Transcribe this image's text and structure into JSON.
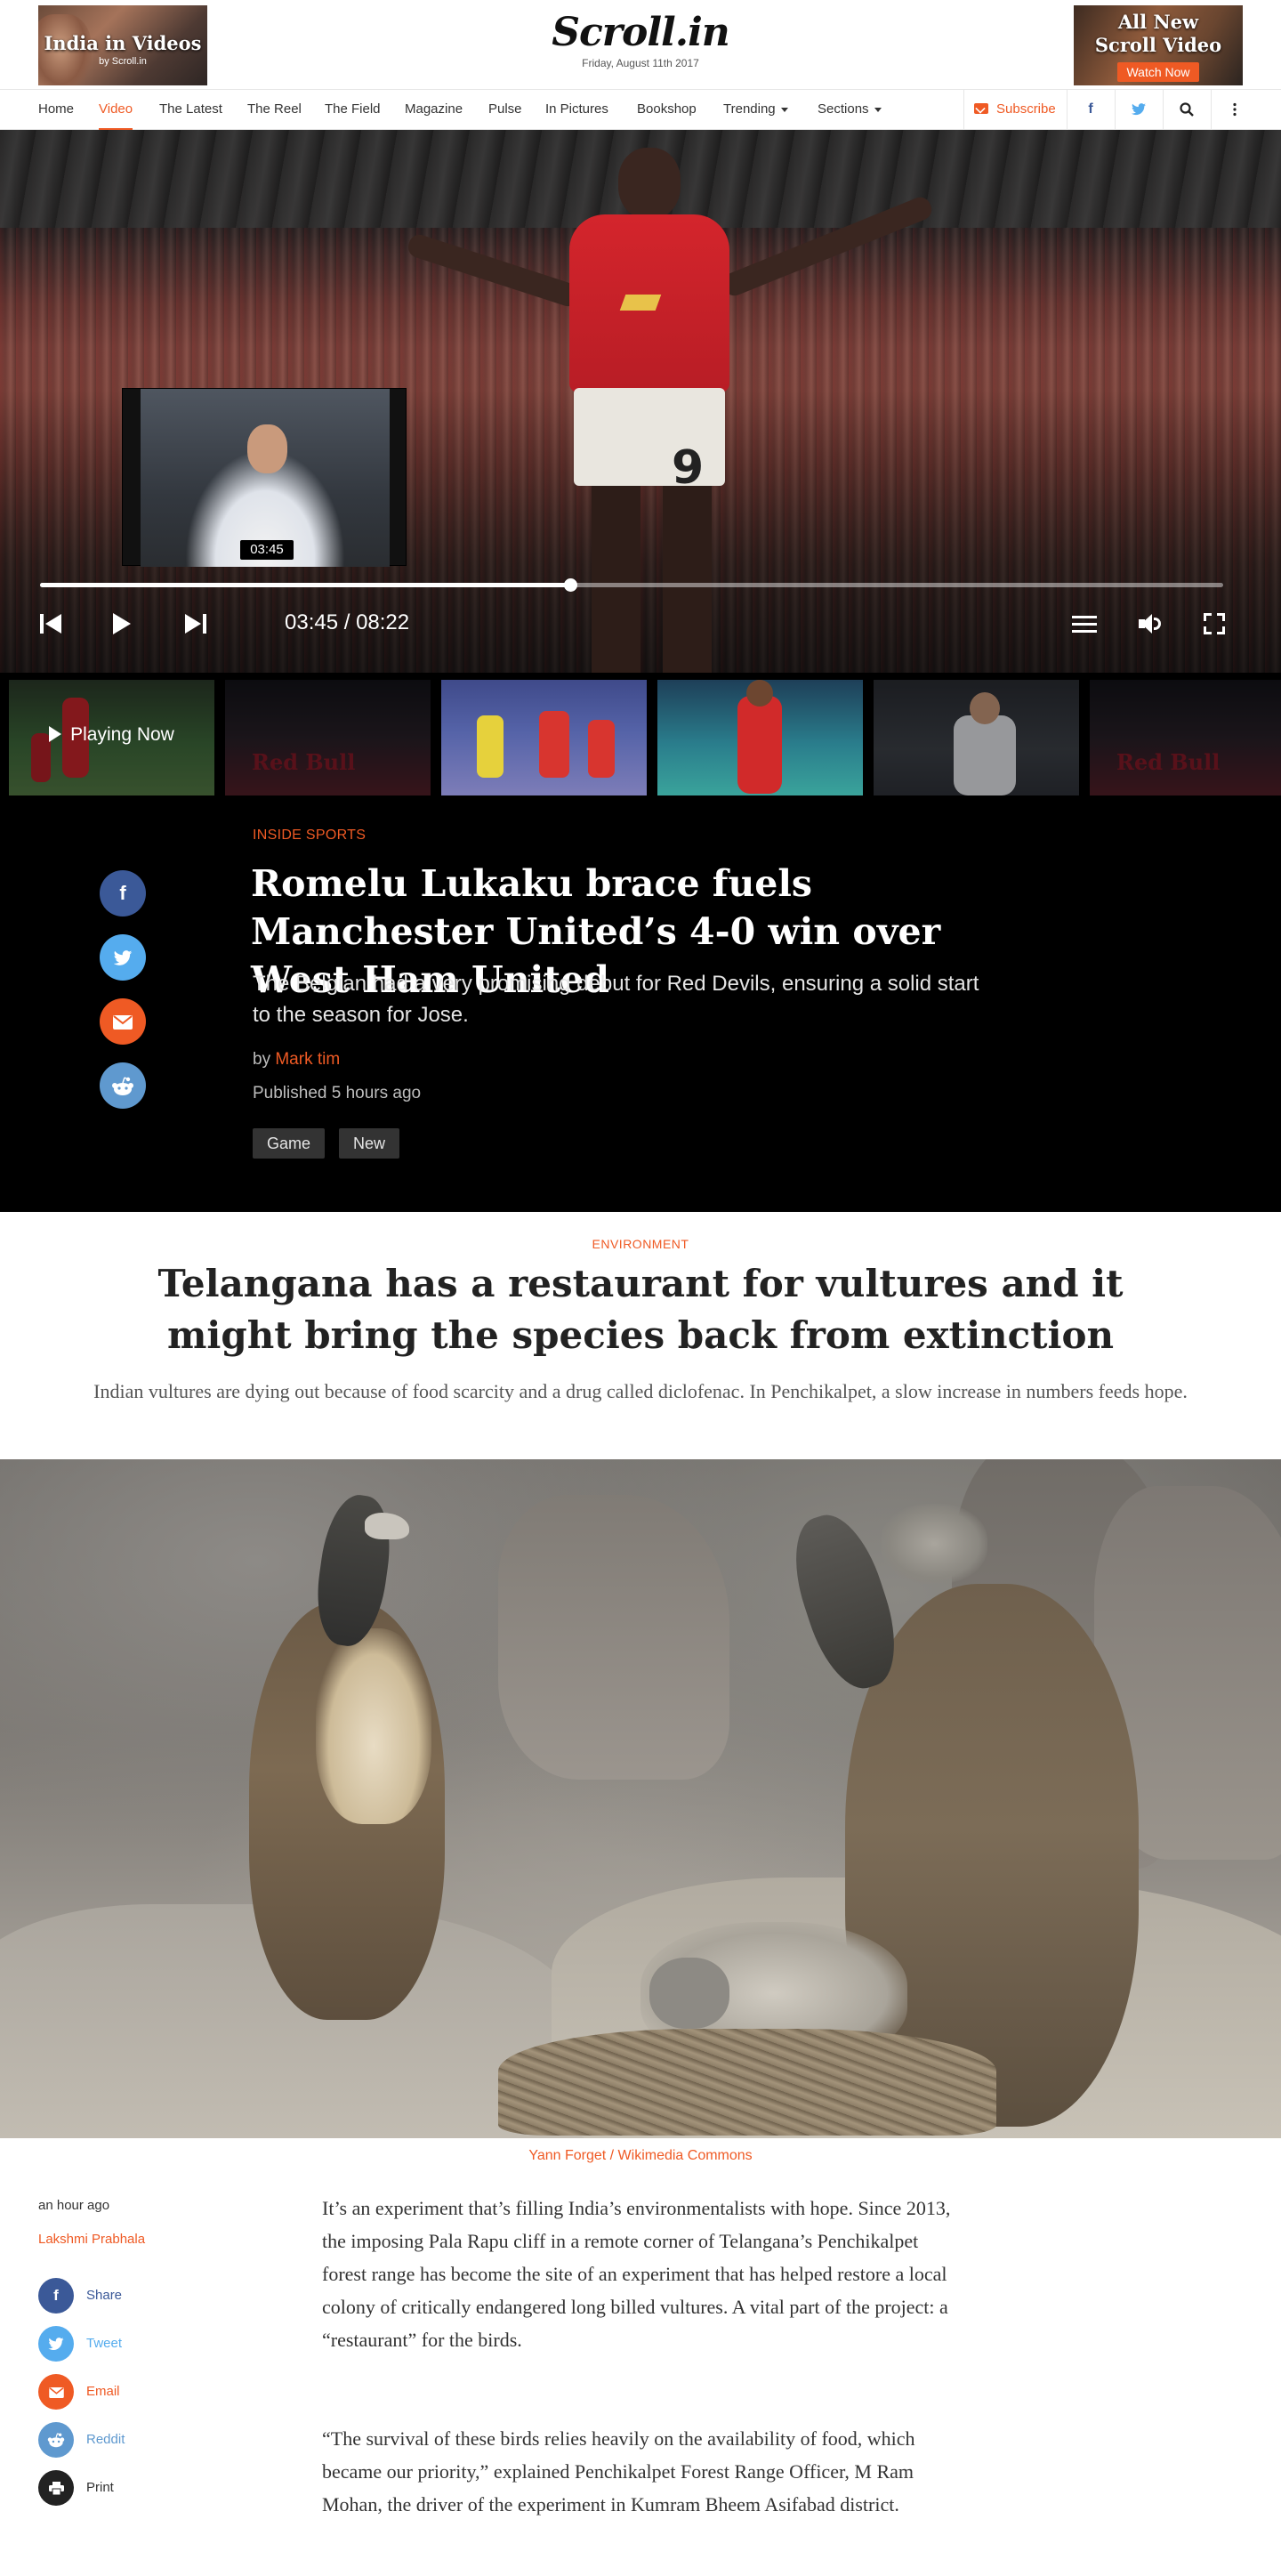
{
  "header": {
    "promo_left": {
      "title": "India in Videos",
      "subtitle": "by Scroll.in"
    },
    "logo": "Scroll.in",
    "date": "Friday, August 11th 2017",
    "promo_right": {
      "title_line1": "All New",
      "title_line2": "Scroll Video",
      "button": "Watch Now"
    }
  },
  "nav": {
    "items": [
      "Home",
      "Video",
      "The Latest",
      "The Reel",
      "The Field",
      "Magazine",
      "Pulse",
      "In Pictures",
      "Bookshop",
      "Trending",
      "Sections"
    ],
    "active": "Video",
    "subscribe": "Subscribe",
    "icons": [
      "facebook-icon",
      "twitter-icon",
      "search-icon",
      "more-vertical-icon"
    ],
    "colors": {
      "accent": "#ef5a24",
      "facebook": "#3b5998",
      "twitter": "#55acee"
    }
  },
  "player": {
    "preview_time": "03:45",
    "current_time": "03:45",
    "duration": "08:22",
    "time_readout": "03:45 / 08:22",
    "progress_fraction": 0.448
  },
  "thumbnails": {
    "playing_label": "Playing Now",
    "items": [
      "soccer-celebration",
      "red-bull-motocross",
      "kabaddi-match",
      "badminton-player",
      "football-player-white-kit",
      "red-bull-motocross"
    ]
  },
  "feature": {
    "kicker": "INSIDE SPORTS",
    "title": "Romelu Lukaku brace fuels Manchester United’s 4-0 win over West Ham United",
    "subtitle": "The Belgian had a very promising debut for Red Devils, ensuring a solid start to the season for Jose.",
    "by": "by",
    "author": "Mark tim",
    "published": "Published 5 hours ago",
    "tags": [
      "Game",
      "New"
    ],
    "share_icons": [
      "facebook-icon",
      "twitter-icon",
      "email-icon",
      "reddit-icon"
    ]
  },
  "article": {
    "kicker": "ENVIRONMENT",
    "title": "Telangana has a restaurant for vultures and it might bring the species back from extinction",
    "subtitle": "Indian vultures are dying out because of food scarcity and a drug called diclofenac. In Penchikalpet, a slow increase in numbers feeds hope.",
    "image_caption": "Yann Forget / Wikimedia Commons",
    "time": "an hour ago",
    "author": "Lakshmi Prabhala",
    "share": [
      "Share",
      "Tweet",
      "Email",
      "Reddit",
      "Print"
    ],
    "paragraphs": [
      "It’s an experiment that’s filling India’s environmentalists with hope. Since 2013, the imposing Pala Rapu cliff in a remote corner of Telangana’s Penchikalpet forest range has become the site of an experiment that has helped restore a local colony of critically endangered long billed vultures. A vital part of the project: a “restaurant” for the birds.",
      "“The survival of these birds relies heavily on the availability of food, which became our priority,” explained Penchikalpet Forest Range Officer, M Ram Mohan, the driver of the experiment in Kumram Bheem Asifabad district."
    ]
  }
}
